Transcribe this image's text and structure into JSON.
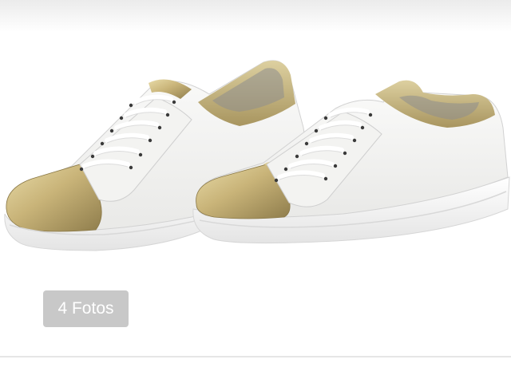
{
  "gallery": {
    "photo_count_label": "4 Fotos",
    "image_subject": "white-and-gold-sneakers",
    "colors": {
      "badge_background": "#c8c8c8",
      "badge_text": "#ffffff",
      "shoe_white": "#f4f4f2",
      "shoe_gold": "#c9b479"
    }
  }
}
